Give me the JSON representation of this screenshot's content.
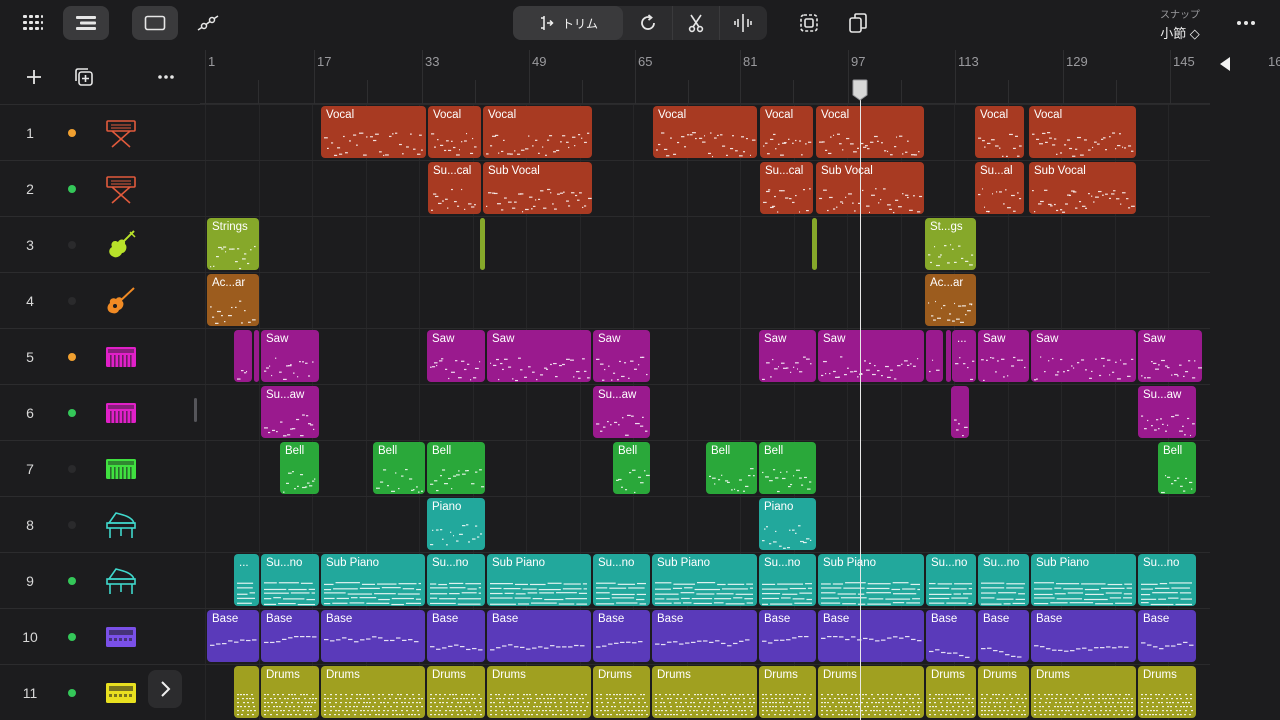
{
  "toolbar": {
    "trim_label": "トリム",
    "snap_label": "スナップ",
    "snap_value": "小節 ◇"
  },
  "ruler": {
    "labels": [
      "1",
      "17",
      "33",
      "49",
      "65",
      "81",
      "97",
      "113",
      "129",
      "145",
      "16"
    ]
  },
  "tracks": [
    {
      "number": "1",
      "icon": "keyboard-x-icon",
      "color": "#e15a3c",
      "dot": "#f0a030"
    },
    {
      "number": "2",
      "icon": "keyboard-x-icon",
      "color": "#e15a3c",
      "dot": "#34c759"
    },
    {
      "number": "3",
      "icon": "violin-icon",
      "color": "#b8e22a",
      "dot": "#2a2a2c"
    },
    {
      "number": "4",
      "icon": "guitar-icon",
      "color": "#f08a24",
      "dot": "#2a2a2c"
    },
    {
      "number": "5",
      "icon": "synth-keyboard-icon",
      "color": "#e020c8",
      "dot": "#f0a030"
    },
    {
      "number": "6",
      "icon": "synth-keyboard-icon",
      "color": "#e020c8",
      "dot": "#34c759"
    },
    {
      "number": "7",
      "icon": "synth-keyboard-icon",
      "color": "#40e040",
      "dot": "#2a2a2c"
    },
    {
      "number": "8",
      "icon": "grand-piano-icon",
      "color": "#40d8cc",
      "dot": "#2a2a2c"
    },
    {
      "number": "9",
      "icon": "grand-piano-icon",
      "color": "#40d8cc",
      "dot": "#34c759"
    },
    {
      "number": "10",
      "icon": "drum-machine-icon",
      "color": "#7a50e8",
      "dot": "#34c759"
    },
    {
      "number": "11",
      "icon": "drum-machine-icon",
      "color": "#e8e020",
      "dot": "#34c759"
    }
  ],
  "regions": [
    {
      "track": 0,
      "start": 121,
      "width": 105,
      "name": "Vocal",
      "color": "#a83a22"
    },
    {
      "track": 0,
      "start": 228,
      "width": 53,
      "name": "Vocal",
      "color": "#a83a22"
    },
    {
      "track": 0,
      "start": 283,
      "width": 109,
      "name": "Vocal",
      "color": "#a83a22"
    },
    {
      "track": 0,
      "start": 453,
      "width": 104,
      "name": "Vocal",
      "color": "#a83a22"
    },
    {
      "track": 0,
      "start": 560,
      "width": 53,
      "name": "Vocal",
      "color": "#a83a22"
    },
    {
      "track": 0,
      "start": 616,
      "width": 108,
      "name": "Vocal",
      "color": "#a83a22"
    },
    {
      "track": 0,
      "start": 775,
      "width": 49,
      "name": "Vocal",
      "color": "#a83a22"
    },
    {
      "track": 0,
      "start": 829,
      "width": 107,
      "name": "Vocal",
      "color": "#a83a22"
    },
    {
      "track": 1,
      "start": 228,
      "width": 53,
      "name": "Su...cal",
      "color": "#a83a22"
    },
    {
      "track": 1,
      "start": 283,
      "width": 109,
      "name": "Sub Vocal",
      "color": "#a83a22"
    },
    {
      "track": 1,
      "start": 560,
      "width": 53,
      "name": "Su...cal",
      "color": "#a83a22"
    },
    {
      "track": 1,
      "start": 616,
      "width": 108,
      "name": "Sub Vocal",
      "color": "#a83a22"
    },
    {
      "track": 1,
      "start": 775,
      "width": 49,
      "name": "Su...al",
      "color": "#a83a22"
    },
    {
      "track": 1,
      "start": 829,
      "width": 107,
      "name": "Sub Vocal",
      "color": "#a83a22"
    },
    {
      "track": 2,
      "start": 7,
      "width": 52,
      "name": "Strings",
      "color": "#86a82a"
    },
    {
      "track": 2,
      "start": 280,
      "width": 5,
      "name": "",
      "color": "#86a82a"
    },
    {
      "track": 2,
      "start": 612,
      "width": 5,
      "name": "",
      "color": "#86a82a"
    },
    {
      "track": 2,
      "start": 725,
      "width": 51,
      "name": "St...gs",
      "color": "#86a82a"
    },
    {
      "track": 3,
      "start": 7,
      "width": 52,
      "name": "Ac...ar",
      "color": "#9c5c1e"
    },
    {
      "track": 3,
      "start": 725,
      "width": 51,
      "name": "Ac...ar",
      "color": "#9c5c1e"
    },
    {
      "track": 4,
      "start": 34,
      "width": 18,
      "name": "",
      "color": "#9a1a8e"
    },
    {
      "track": 4,
      "start": 54,
      "width": 5,
      "name": "",
      "color": "#9a1a8e"
    },
    {
      "track": 4,
      "start": 61,
      "width": 58,
      "name": "Saw",
      "color": "#9a1a8e"
    },
    {
      "track": 4,
      "start": 227,
      "width": 58,
      "name": "Saw",
      "color": "#9a1a8e"
    },
    {
      "track": 4,
      "start": 287,
      "width": 104,
      "name": "Saw",
      "color": "#9a1a8e"
    },
    {
      "track": 4,
      "start": 393,
      "width": 57,
      "name": "Saw",
      "color": "#9a1a8e"
    },
    {
      "track": 4,
      "start": 559,
      "width": 57,
      "name": "Saw",
      "color": "#9a1a8e"
    },
    {
      "track": 4,
      "start": 618,
      "width": 106,
      "name": "Saw",
      "color": "#9a1a8e"
    },
    {
      "track": 4,
      "start": 726,
      "width": 17,
      "name": "",
      "color": "#9a1a8e"
    },
    {
      "track": 4,
      "start": 746,
      "width": 5,
      "name": "",
      "color": "#9a1a8e"
    },
    {
      "track": 4,
      "start": 752,
      "width": 24,
      "name": "...",
      "color": "#9a1a8e"
    },
    {
      "track": 4,
      "start": 778,
      "width": 51,
      "name": "Saw",
      "color": "#9a1a8e"
    },
    {
      "track": 4,
      "start": 831,
      "width": 105,
      "name": "Saw",
      "color": "#9a1a8e"
    },
    {
      "track": 4,
      "start": 938,
      "width": 64,
      "name": "Saw",
      "color": "#9a1a8e"
    },
    {
      "track": 5,
      "start": 61,
      "width": 58,
      "name": "Su...aw",
      "color": "#9a1a8e"
    },
    {
      "track": 5,
      "start": 393,
      "width": 57,
      "name": "Su...aw",
      "color": "#9a1a8e"
    },
    {
      "track": 5,
      "start": 751,
      "width": 18,
      "name": "",
      "color": "#9a1a8e"
    },
    {
      "track": 5,
      "start": 938,
      "width": 58,
      "name": "Su...aw",
      "color": "#9a1a8e"
    },
    {
      "track": 6,
      "start": 80,
      "width": 39,
      "name": "Bell",
      "color": "#2aa83a"
    },
    {
      "track": 6,
      "start": 173,
      "width": 52,
      "name": "Bell",
      "color": "#2aa83a"
    },
    {
      "track": 6,
      "start": 227,
      "width": 58,
      "name": "Bell",
      "color": "#2aa83a"
    },
    {
      "track": 6,
      "start": 413,
      "width": 37,
      "name": "Bell",
      "color": "#2aa83a"
    },
    {
      "track": 6,
      "start": 506,
      "width": 51,
      "name": "Bell",
      "color": "#2aa83a"
    },
    {
      "track": 6,
      "start": 559,
      "width": 57,
      "name": "Bell",
      "color": "#2aa83a"
    },
    {
      "track": 6,
      "start": 958,
      "width": 38,
      "name": "Bell",
      "color": "#2aa83a"
    },
    {
      "track": 7,
      "start": 227,
      "width": 58,
      "name": "Piano",
      "color": "#22a89c"
    },
    {
      "track": 7,
      "start": 559,
      "width": 57,
      "name": "Piano",
      "color": "#22a89c"
    },
    {
      "track": 8,
      "start": 34,
      "width": 25,
      "name": "...",
      "color": "#22a89c"
    },
    {
      "track": 8,
      "start": 61,
      "width": 58,
      "name": "Su...no",
      "color": "#22a89c"
    },
    {
      "track": 8,
      "start": 121,
      "width": 104,
      "name": "Sub Piano",
      "color": "#22a89c"
    },
    {
      "track": 8,
      "start": 227,
      "width": 58,
      "name": "Su...no",
      "color": "#22a89c"
    },
    {
      "track": 8,
      "start": 287,
      "width": 104,
      "name": "Sub Piano",
      "color": "#22a89c"
    },
    {
      "track": 8,
      "start": 393,
      "width": 57,
      "name": "Su...no",
      "color": "#22a89c"
    },
    {
      "track": 8,
      "start": 452,
      "width": 105,
      "name": "Sub Piano",
      "color": "#22a89c"
    },
    {
      "track": 8,
      "start": 559,
      "width": 57,
      "name": "Su...no",
      "color": "#22a89c"
    },
    {
      "track": 8,
      "start": 618,
      "width": 106,
      "name": "Sub Piano",
      "color": "#22a89c"
    },
    {
      "track": 8,
      "start": 726,
      "width": 50,
      "name": "Su...no",
      "color": "#22a89c"
    },
    {
      "track": 8,
      "start": 778,
      "width": 51,
      "name": "Su...no",
      "color": "#22a89c"
    },
    {
      "track": 8,
      "start": 831,
      "width": 105,
      "name": "Sub Piano",
      "color": "#22a89c"
    },
    {
      "track": 8,
      "start": 938,
      "width": 58,
      "name": "Su...no",
      "color": "#22a89c"
    },
    {
      "track": 9,
      "start": 7,
      "width": 52,
      "name": "Base",
      "color": "#5a3aba"
    },
    {
      "track": 9,
      "start": 61,
      "width": 58,
      "name": "Base",
      "color": "#5a3aba"
    },
    {
      "track": 9,
      "start": 121,
      "width": 104,
      "name": "Base",
      "color": "#5a3aba"
    },
    {
      "track": 9,
      "start": 227,
      "width": 58,
      "name": "Base",
      "color": "#5a3aba"
    },
    {
      "track": 9,
      "start": 287,
      "width": 104,
      "name": "Base",
      "color": "#5a3aba"
    },
    {
      "track": 9,
      "start": 393,
      "width": 57,
      "name": "Base",
      "color": "#5a3aba"
    },
    {
      "track": 9,
      "start": 452,
      "width": 105,
      "name": "Base",
      "color": "#5a3aba"
    },
    {
      "track": 9,
      "start": 559,
      "width": 57,
      "name": "Base",
      "color": "#5a3aba"
    },
    {
      "track": 9,
      "start": 618,
      "width": 106,
      "name": "Base",
      "color": "#5a3aba"
    },
    {
      "track": 9,
      "start": 726,
      "width": 50,
      "name": "Base",
      "color": "#5a3aba"
    },
    {
      "track": 9,
      "start": 778,
      "width": 51,
      "name": "Base",
      "color": "#5a3aba"
    },
    {
      "track": 9,
      "start": 831,
      "width": 105,
      "name": "Base",
      "color": "#5a3aba"
    },
    {
      "track": 9,
      "start": 938,
      "width": 58,
      "name": "Base",
      "color": "#5a3aba"
    },
    {
      "track": 10,
      "start": 34,
      "width": 25,
      "name": "",
      "color": "#a0a020"
    },
    {
      "track": 10,
      "start": 61,
      "width": 58,
      "name": "Drums",
      "color": "#a0a020"
    },
    {
      "track": 10,
      "start": 121,
      "width": 104,
      "name": "Drums",
      "color": "#a0a020"
    },
    {
      "track": 10,
      "start": 227,
      "width": 58,
      "name": "Drums",
      "color": "#a0a020"
    },
    {
      "track": 10,
      "start": 287,
      "width": 104,
      "name": "Drums",
      "color": "#a0a020"
    },
    {
      "track": 10,
      "start": 393,
      "width": 57,
      "name": "Drums",
      "color": "#a0a020"
    },
    {
      "track": 10,
      "start": 452,
      "width": 105,
      "name": "Drums",
      "color": "#a0a020"
    },
    {
      "track": 10,
      "start": 559,
      "width": 57,
      "name": "Drums",
      "color": "#a0a020"
    },
    {
      "track": 10,
      "start": 618,
      "width": 106,
      "name": "Drums",
      "color": "#a0a020"
    },
    {
      "track": 10,
      "start": 726,
      "width": 50,
      "name": "Drums",
      "color": "#a0a020"
    },
    {
      "track": 10,
      "start": 778,
      "width": 51,
      "name": "Drums",
      "color": "#a0a020"
    },
    {
      "track": 10,
      "start": 831,
      "width": 105,
      "name": "Drums",
      "color": "#a0a020"
    },
    {
      "track": 10,
      "start": 938,
      "width": 58,
      "name": "Drums",
      "color": "#a0a020"
    }
  ]
}
